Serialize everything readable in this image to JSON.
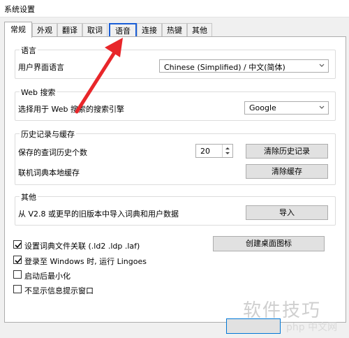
{
  "window": {
    "title": "系统设置"
  },
  "tabs": [
    "常规",
    "外观",
    "翻译",
    "取词",
    "语音",
    "连接",
    "热键",
    "其他"
  ],
  "language": {
    "group_title": "语言",
    "ui_language_label": "用户界面语言",
    "ui_language_value": "Chinese (Simplified)  /  中文(简体)"
  },
  "web_search": {
    "group_title": "Web 搜索",
    "engine_label": "选择用于 Web 搜索的搜索引擎",
    "engine_value": "Google"
  },
  "history": {
    "group_title": "历史记录与缓存",
    "count_label": "保存的查词历史个数",
    "count_value": "20",
    "clear_history_button": "清除历史记录",
    "cache_label": "联机词典本地缓存",
    "clear_cache_button": "清除缓存"
  },
  "other": {
    "group_title": "其他",
    "import_label": "从 V2.8 或更早的旧版本中导入词典和用户数据",
    "import_button": "导入"
  },
  "options": {
    "associate_label": "设置词典文件关联 (.ld2 .ldp .laf)",
    "associate_checked": true,
    "create_shortcut_button": "创建桌面图标",
    "startup_label": "登录至 Windows 时, 运行 Lingoes",
    "startup_checked": true,
    "minimize_label": "启动后最小化",
    "minimize_checked": false,
    "no_tips_label": "不显示信息提示窗口",
    "no_tips_checked": false
  },
  "watermark": {
    "main": "软件技巧",
    "sub": "php 中文网"
  },
  "colors": {
    "arrow": "#e8262a",
    "tab_highlight": "#1b5fd8"
  }
}
